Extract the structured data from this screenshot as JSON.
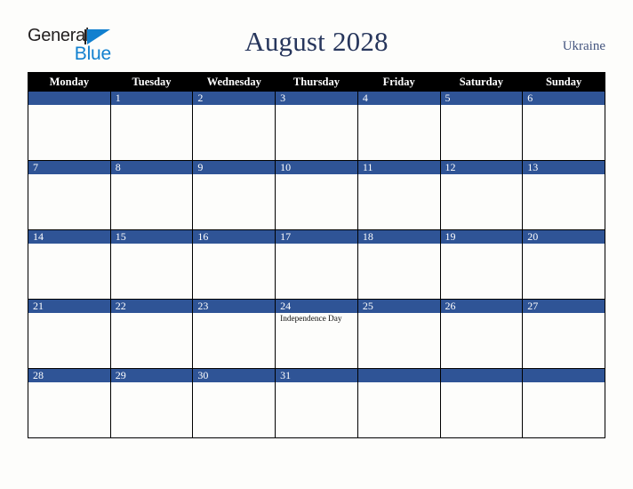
{
  "brand": {
    "name_top": "General",
    "name_bottom": "Blue",
    "triangle_color": "#1180cf"
  },
  "header": {
    "title": "August 2028",
    "country": "Ukraine"
  },
  "colors": {
    "header_row_bg": "#000000",
    "day_number_bg": "#2f5496",
    "title_color": "#27365c",
    "page_bg": "#fdfdfb"
  },
  "calendar": {
    "weekday_headers": [
      "Monday",
      "Tuesday",
      "Wednesday",
      "Thursday",
      "Friday",
      "Saturday",
      "Sunday"
    ],
    "weeks": [
      [
        {
          "day": "",
          "events": []
        },
        {
          "day": "1",
          "events": []
        },
        {
          "day": "2",
          "events": []
        },
        {
          "day": "3",
          "events": []
        },
        {
          "day": "4",
          "events": []
        },
        {
          "day": "5",
          "events": []
        },
        {
          "day": "6",
          "events": []
        }
      ],
      [
        {
          "day": "7",
          "events": []
        },
        {
          "day": "8",
          "events": []
        },
        {
          "day": "9",
          "events": []
        },
        {
          "day": "10",
          "events": []
        },
        {
          "day": "11",
          "events": []
        },
        {
          "day": "12",
          "events": []
        },
        {
          "day": "13",
          "events": []
        }
      ],
      [
        {
          "day": "14",
          "events": []
        },
        {
          "day": "15",
          "events": []
        },
        {
          "day": "16",
          "events": []
        },
        {
          "day": "17",
          "events": []
        },
        {
          "day": "18",
          "events": []
        },
        {
          "day": "19",
          "events": []
        },
        {
          "day": "20",
          "events": []
        }
      ],
      [
        {
          "day": "21",
          "events": []
        },
        {
          "day": "22",
          "events": []
        },
        {
          "day": "23",
          "events": []
        },
        {
          "day": "24",
          "events": [
            "Independence Day"
          ]
        },
        {
          "day": "25",
          "events": []
        },
        {
          "day": "26",
          "events": []
        },
        {
          "day": "27",
          "events": []
        }
      ],
      [
        {
          "day": "28",
          "events": []
        },
        {
          "day": "29",
          "events": []
        },
        {
          "day": "30",
          "events": []
        },
        {
          "day": "31",
          "events": []
        },
        {
          "day": "",
          "events": []
        },
        {
          "day": "",
          "events": []
        },
        {
          "day": "",
          "events": []
        }
      ]
    ]
  }
}
